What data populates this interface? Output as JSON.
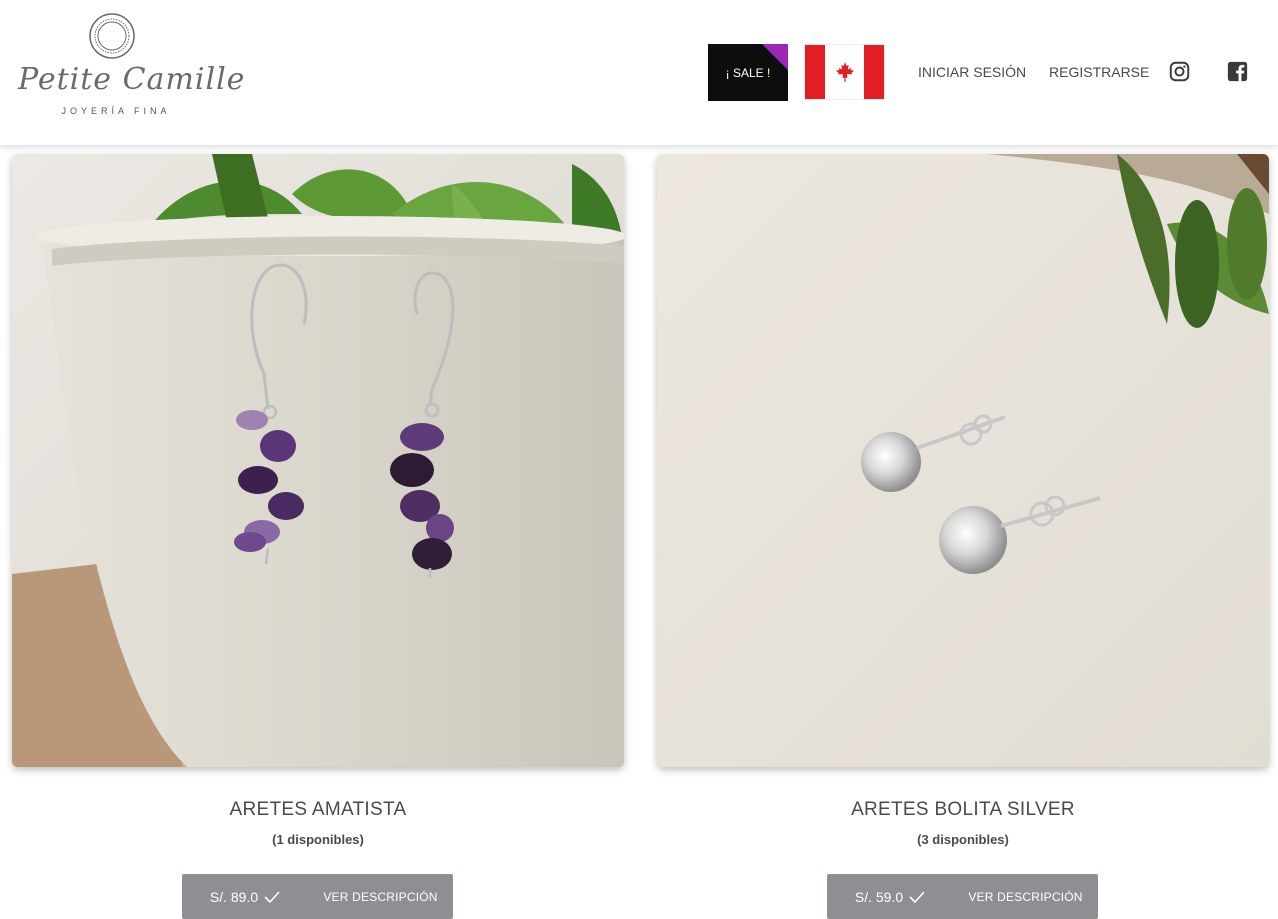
{
  "brand": {
    "name": "Petite Camille",
    "tagline": "JOYERÍA FINA"
  },
  "header": {
    "sale_label": "¡ SALE !",
    "flag_icon": "canada-flag-icon",
    "login_label": "INICIAR SESIÓN",
    "register_label": "REGISTRARSE",
    "instagram_icon": "instagram-icon",
    "facebook_icon": "facebook-icon",
    "accent_color": "#9b27b8"
  },
  "products": [
    {
      "title": "ARETES AMATISTA",
      "availability": "(1 disponibles)",
      "price": "S/. 89.0",
      "button_label": "VER DESCRIPCIÓN"
    },
    {
      "title": "ARETES BOLITA SILVER",
      "availability": "(3 disponibles)",
      "price": "S/. 59.0",
      "button_label": "VER DESCRIPCIÓN"
    }
  ],
  "colors": {
    "action_bar": "#8d8f92",
    "flag_red": "#e31f26"
  }
}
